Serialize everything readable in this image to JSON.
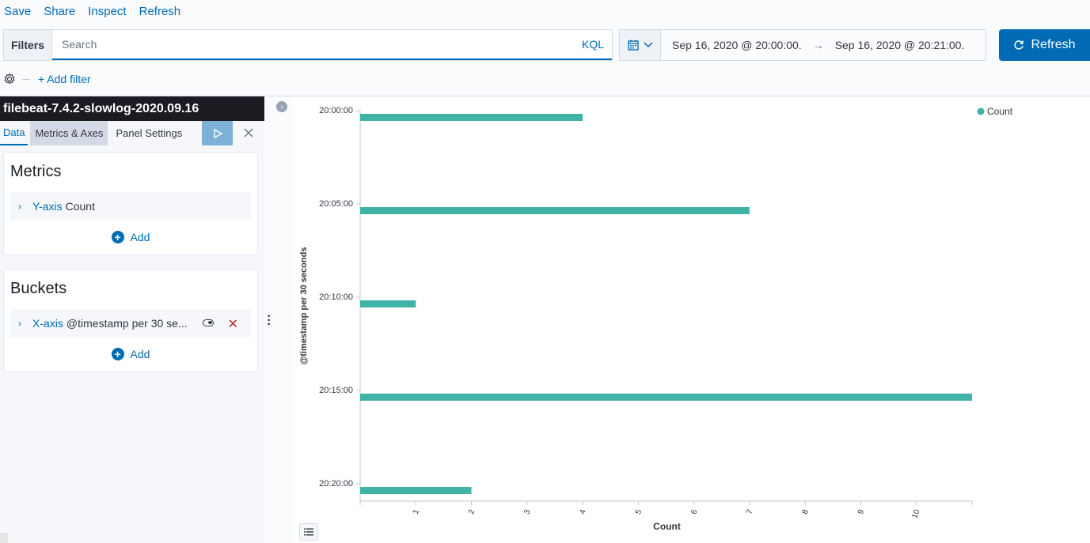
{
  "topnav": {
    "items": [
      "Save",
      "Share",
      "Inspect",
      "Refresh"
    ]
  },
  "querybar": {
    "filters_label": "Filters",
    "search_placeholder": "Search",
    "language": "KQL"
  },
  "datepicker": {
    "start": "Sep 16, 2020 @ 20:00:00.",
    "arrow": "→",
    "end": "Sep 16, 2020 @ 20:21:00."
  },
  "refresh_button": {
    "label": "Refresh"
  },
  "filter_row": {
    "add_filter": "+ Add filter"
  },
  "sidebar": {
    "index_title": "filebeat-7.4.2-slowlog-2020.09.16",
    "tabs": [
      "Data",
      "Metrics & Axes",
      "Panel Settings"
    ],
    "metrics": {
      "title": "Metrics",
      "row": {
        "axis": "Y-axis",
        "desc": "Count"
      },
      "add_label": "Add"
    },
    "buckets": {
      "title": "Buckets",
      "row": {
        "axis": "X-axis",
        "desc": "@timestamp per 30 se..."
      },
      "add_label": "Add"
    }
  },
  "colors": {
    "accent": "#006bb4",
    "bar": "#3eb3a6",
    "header_dark": "#1a1c21"
  },
  "chart_data": {
    "type": "bar",
    "orientation": "horizontal",
    "categories": [
      "20:00:00",
      "20:05:00",
      "20:10:00",
      "20:15:00",
      "20:20:00"
    ],
    "series": [
      {
        "name": "Count",
        "values": [
          4,
          7,
          1,
          11,
          2
        ]
      }
    ],
    "xlabel": "Count",
    "ylabel": "@timestamp per 30 seconds",
    "xticks": [
      "1",
      "2",
      "3",
      "4",
      "5",
      "6",
      "7",
      "8",
      "9",
      "10"
    ],
    "xlim": [
      0,
      11
    ],
    "legend": "top-right",
    "grid": false
  }
}
